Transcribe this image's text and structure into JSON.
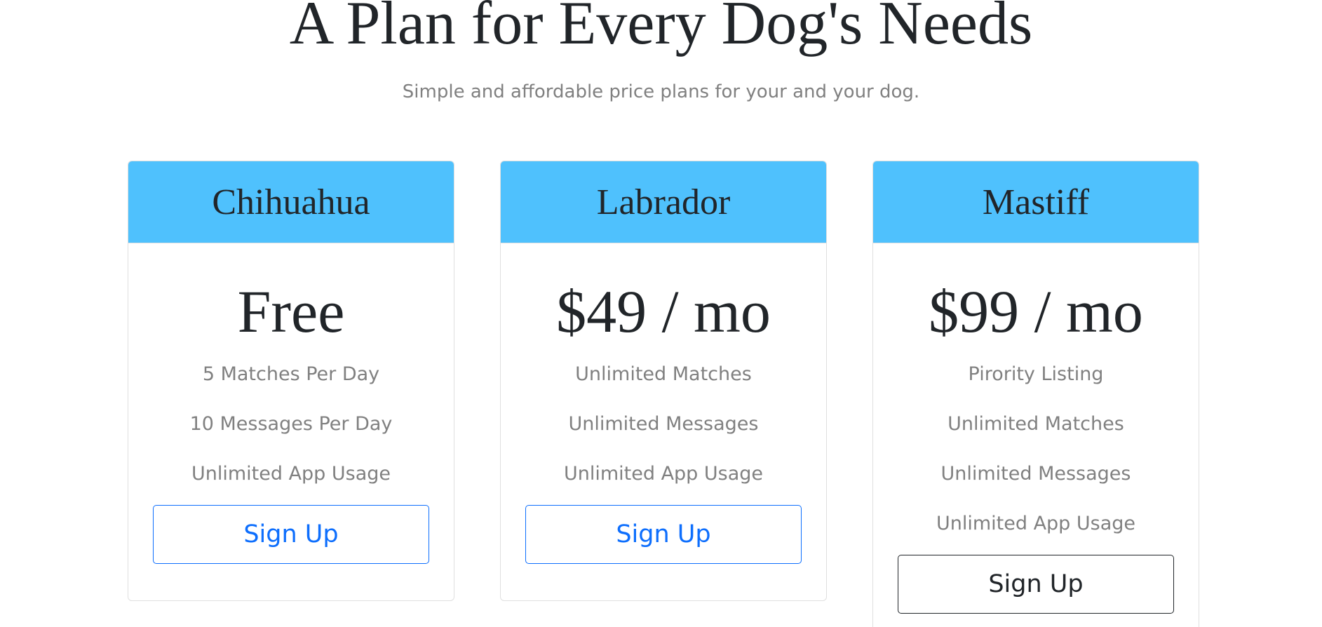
{
  "pricing": {
    "title": "A Plan for Every Dog's Needs",
    "subtitle": "Simple and affordable price plans for your and your dog."
  },
  "plans": [
    {
      "name": "Chihuahua",
      "price": "Free",
      "features": [
        "5 Matches Per Day",
        "10 Messages Per Day",
        "Unlimited App Usage"
      ],
      "button_label": "Sign Up"
    },
    {
      "name": "Labrador",
      "price": "$49 / mo",
      "features": [
        "Unlimited Matches",
        "Unlimited Messages",
        "Unlimited App Usage"
      ],
      "button_label": "Sign Up"
    },
    {
      "name": "Mastiff",
      "price": "$99 / mo",
      "features": [
        "Pirority Listing",
        "Unlimited Matches",
        "Unlimited Messages",
        "Unlimited App Usage"
      ],
      "button_label": "Sign Up"
    }
  ],
  "colors": {
    "header_bg": "#4fc1fd",
    "primary_blue": "#0d6efd",
    "text_dark": "#212529",
    "text_muted": "#808080"
  }
}
